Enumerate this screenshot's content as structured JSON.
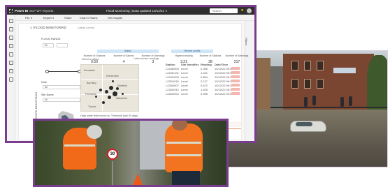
{
  "window": {
    "app_name": "Power BI",
    "workspace": "SCP WT Reports",
    "report_title": "Flood Monitoring | Data updated 10/12/22 ∨",
    "search_placeholder": "Search"
  },
  "toolbar": {
    "items": [
      "File ∨",
      "Export ∨",
      "Share",
      "Chat in Teams",
      "Get insights"
    ]
  },
  "right_panel": {
    "filters_label": "Filters"
  },
  "report": {
    "title": "1 | FLOOD MONITORING",
    "subtitle": "Latest Levels",
    "side_label": "SOUTH YORKSHIRE MONITORING",
    "slicers": [
      {
        "label": "FLOOD RANGE",
        "value": "All"
      },
      {
        "label": "Date",
        "value": "All"
      },
      {
        "label": "Site Name",
        "value": "All"
      }
    ],
    "kpi_groups": [
      {
        "title": "Status",
        "kpis": [
          {
            "label": "Number of Stations",
            "value": "0.50"
          },
          {
            "label": "Number of Alarms",
            "value": "4"
          },
          {
            "label": "Number of Warnings",
            "value": "3"
          }
        ]
      },
      {
        "title": "Recent Levels",
        "kpis": [
          {
            "label": "Highest reading",
            "value": "3.21"
          },
          {
            "label": "Number of Stations",
            "value": "28"
          },
          {
            "label": "Number of Warnings",
            "value": "217"
          }
        ]
      }
    ],
    "map": {
      "select_label": "Select a station",
      "places": [
        "Doncaster",
        "Rotherham",
        "Barnsley",
        "Sheffield",
        "Penistone",
        "Wakefield",
        "Thorne"
      ]
    },
    "table": {
      "title": "Latest sensor readings",
      "columns": [
        "Station",
        "Site Identifier",
        "Reading",
        "Date/Time"
      ],
      "rows": [
        [
          "L2236/009",
          "Level",
          "0.356",
          "10/12/22 09:45"
        ],
        [
          "L2240/101",
          "Level",
          "1.021",
          "10/12/22 09:45"
        ],
        [
          "L2242/004",
          "Level",
          "0.884",
          "10/12/22 09:30"
        ],
        [
          "L2251/010",
          "Level",
          "2.117",
          "10/12/22 09:30"
        ],
        [
          "L2255/007",
          "Level",
          "0.672",
          "10/12/22 09:15"
        ],
        [
          "L2260/012",
          "Level",
          "1.405",
          "10/12/22 09:15"
        ],
        [
          "L2263/002",
          "Level",
          "0.998",
          "10/12/22 09:00"
        ]
      ]
    },
    "timeline": {
      "title": "Daily water level record vs. Threshold (last 30 days)"
    }
  },
  "photos": {
    "workers_sign": "30"
  }
}
